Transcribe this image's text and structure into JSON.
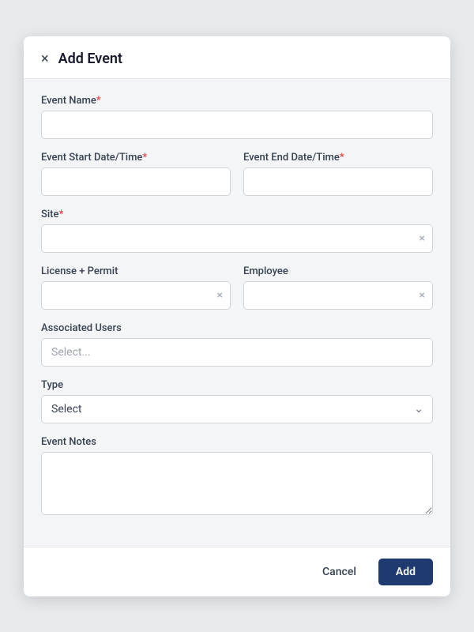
{
  "modal": {
    "title": "Add Event",
    "close_label": "×"
  },
  "form": {
    "event_name_label": "Event Name",
    "event_start_label": "Event Start Date/Time",
    "event_end_label": "Event End Date/Time",
    "site_label": "Site",
    "license_label": "License + Permit",
    "employee_label": "Employee",
    "associated_users_label": "Associated Users",
    "associated_users_placeholder": "Select...",
    "type_label": "Type",
    "type_default": "Select",
    "event_notes_label": "Event Notes"
  },
  "footer": {
    "cancel_label": "Cancel",
    "add_label": "Add"
  },
  "icons": {
    "close": "×",
    "clear": "×",
    "chevron_down": "⌄"
  }
}
